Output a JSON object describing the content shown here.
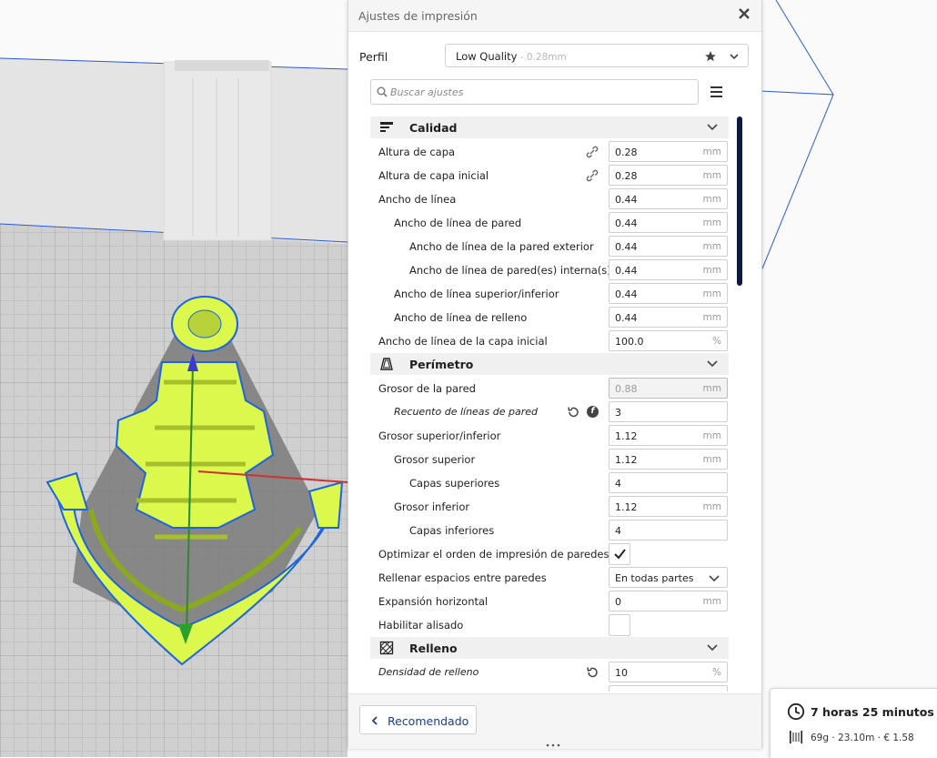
{
  "panel": {
    "title": "Ajustes de impresión",
    "profile_label": "Perfil",
    "profile_name": "Low Quality",
    "profile_sub": " - 0.28mm",
    "search_placeholder": "Buscar ajustes"
  },
  "categories": {
    "calidad": "Calidad",
    "perimetro": "Perímetro",
    "relleno": "Relleno"
  },
  "settings": {
    "altura_capa": {
      "label": "Altura de capa",
      "value": "0.28",
      "unit": "mm"
    },
    "altura_capa_inicial": {
      "label": "Altura de capa inicial",
      "value": "0.28",
      "unit": "mm"
    },
    "ancho_linea": {
      "label": "Ancho de línea",
      "value": "0.44",
      "unit": "mm"
    },
    "ancho_linea_pared": {
      "label": "Ancho de línea de pared",
      "value": "0.44",
      "unit": "mm"
    },
    "ancho_pared_exterior": {
      "label": "Ancho de línea de la pared exterior",
      "value": "0.44",
      "unit": "mm"
    },
    "ancho_pared_interna": {
      "label": "Ancho de línea de pared(es) interna(s)",
      "value": "0.44",
      "unit": "mm"
    },
    "ancho_sup_inf": {
      "label": "Ancho de línea superior/inferior",
      "value": "0.44",
      "unit": "mm"
    },
    "ancho_relleno": {
      "label": "Ancho de línea de relleno",
      "value": "0.44",
      "unit": "mm"
    },
    "ancho_capa_inicial": {
      "label": "Ancho de línea de la capa inicial",
      "value": "100.0",
      "unit": "%"
    },
    "grosor_pared": {
      "label": "Grosor de la pared",
      "value": "0.88",
      "unit": "mm"
    },
    "recuento_lineas": {
      "label": "Recuento de líneas de pared",
      "value": "3"
    },
    "grosor_sup_inf": {
      "label": "Grosor superior/inferior",
      "value": "1.12",
      "unit": "mm"
    },
    "grosor_superior": {
      "label": "Grosor superior",
      "value": "1.12",
      "unit": "mm"
    },
    "capas_superiores": {
      "label": "Capas superiores",
      "value": "4"
    },
    "grosor_inferior": {
      "label": "Grosor inferior",
      "value": "1.12",
      "unit": "mm"
    },
    "capas_inferiores": {
      "label": "Capas inferiores",
      "value": "4"
    },
    "optimizar_orden": {
      "label": "Optimizar el orden de impresión de paredes",
      "checked": true
    },
    "rellenar_espacios": {
      "label": "Rellenar espacios entre paredes",
      "value": "En todas partes"
    },
    "expansion_horizontal": {
      "label": "Expansión horizontal",
      "value": "0",
      "unit": "mm"
    },
    "habilitar_alisado": {
      "label": "Habilitar alisado",
      "checked": false
    },
    "densidad_relleno": {
      "label": "Densidad de relleno",
      "value": "10",
      "unit": "%"
    }
  },
  "footer": {
    "recommended_label": "Recomendado"
  },
  "estimate": {
    "time": "7 horas 25 minutos",
    "detail": "69g · 23.10m · € 1.58"
  },
  "icons": {
    "close": "close-icon",
    "star": "star-icon",
    "search": "search-icon",
    "menu": "menu-icon",
    "link": "link-icon",
    "reset": "reset-icon",
    "function": "function-icon",
    "clock": "clock-icon",
    "spool": "spool-icon"
  },
  "colors": {
    "model": "#dcf84c",
    "model_outline": "#1e64dc",
    "accent": "#1e3c8c",
    "scrollbar": "#0e1a46"
  }
}
